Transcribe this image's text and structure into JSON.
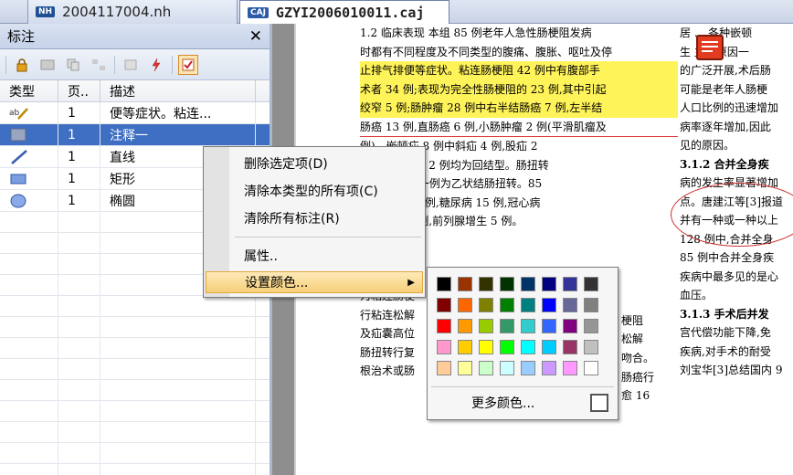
{
  "tabs": [
    {
      "icon": "NH",
      "label": "2004117004.nh"
    },
    {
      "icon": "CAJ",
      "label": "GZYI2006010011.caj"
    }
  ],
  "panel": {
    "title": "标注",
    "close": "✕",
    "columns": [
      "类型",
      "页..",
      "描述"
    ],
    "rows": [
      {
        "type_icon": "text-highlight-icon",
        "page": "1",
        "desc": "便等症状。粘连..."
      },
      {
        "type_icon": "note-icon",
        "page": "1",
        "desc": "注释一"
      },
      {
        "type_icon": "line-icon",
        "page": "1",
        "desc": "直线"
      },
      {
        "type_icon": "rectangle-icon",
        "page": "1",
        "desc": "矩形"
      },
      {
        "type_icon": "ellipse-icon",
        "page": "1",
        "desc": "椭圆"
      }
    ]
  },
  "context_menu": {
    "delete_selected": "删除选定项(D)",
    "clear_type": "清除本类型的所有项(C)",
    "clear_all": "清除所有标注(R)",
    "properties": "属性..",
    "set_color": "设置颜色..."
  },
  "color_menu": {
    "swatches": [
      "#000000",
      "#993300",
      "#333300",
      "#003300",
      "#003366",
      "#000080",
      "#333399",
      "#333333",
      "#800000",
      "#ff6600",
      "#808000",
      "#008000",
      "#008080",
      "#0000ff",
      "#666699",
      "#808080",
      "#ff0000",
      "#ff9900",
      "#99cc00",
      "#339966",
      "#33cccc",
      "#3366ff",
      "#800080",
      "#969696",
      "#ff99cc",
      "#ffcc00",
      "#ffff00",
      "#00ff00",
      "#00ffff",
      "#00ccff",
      "#993366",
      "#c0c0c0",
      "#ffcc99",
      "#ffff99",
      "#ccffcc",
      "#ccffff",
      "#99ccff",
      "#cc99ff",
      "#ff99ff",
      "#ffffff"
    ],
    "more": "更多颜色..."
  },
  "document": {
    "left_lines": [
      "1.2  临床表现  本组 85 例老年人急性肠梗阻发病",
      "时都有不同程度及不同类型的腹痛、腹胀、呕吐及停",
      "止排气排便等症状。粘连肠梗阻 42 例中有腹部手",
      "术者 34 例;表现为完全性肠梗阻的 23 例,其中引起",
      "绞窄 5 例;肠肿瘤 28 例中右半结肠癌 7 例,左半结",
      "肠癌 13 例,直肠癌 6 例,小肠肿瘤 2 例(平滑肌瘤及",
      "                 例)。嵌顿疝 8 例中斜疝 4 例,股疝 2",
      "                 2 例。肠套叠 2 例均为回结型。肠扭转",
      "                 为小肠扭转,一例为乙状结肠扭转。85",
      "                 并高血压 12 例,糖尿病 15 例,冠心病",
      "                 支气管炎 8 例,前列腺增生 5 例。",
      "",
      "",
      "                                                  主要",
      "为粘连肠梗",
      "行粘连松解",
      "及疝囊高位",
      "肠扭转行复",
      "根治术或肠"
    ],
    "right_lines": [
      "居 ... 各种嵌顿",
      "生  主要原因一",
      "的广泛开展,术后肠",
      "可能是老年人肠梗",
      "人口比例的迅速增加",
      "病率逐年增加,因此",
      "见的原因。",
      "3.1.2  合并全身疾",
      "病的发生率显著增加",
      "点。唐建江等[3]报道",
      "并有一种或一种以上",
      "128 例中,合并全身",
      "85 例中合并全身疾",
      "疾病中最多见的是心",
      "血压。",
      "3.1.3  手术后并发",
      "宫代偿功能下降,免",
      "疾病,对手术的耐受",
      "刘宝华[3]总结国内 9"
    ],
    "fragments": [
      "梗阻",
      "松解",
      "吻合。",
      "肠癌行",
      "愈 16"
    ]
  }
}
